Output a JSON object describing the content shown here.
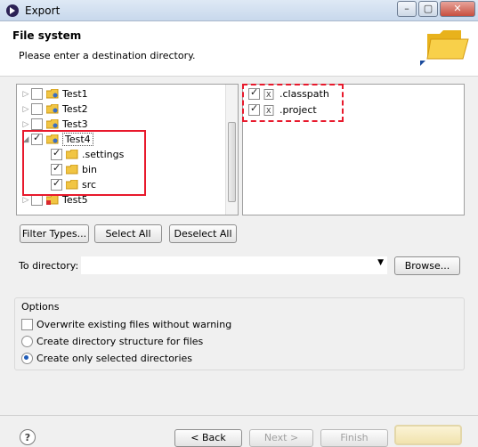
{
  "window": {
    "title": "Export",
    "minimize": "–",
    "maximize": "▢",
    "close": "✕"
  },
  "header": {
    "title": "File system",
    "subtitle": "Please enter a destination directory."
  },
  "left_tree": [
    {
      "label": "Test1",
      "checked": false
    },
    {
      "label": "Test2",
      "checked": false
    },
    {
      "label": "Test3",
      "checked": false
    },
    {
      "label": "Test4",
      "checked": true
    },
    {
      "label": ".settings",
      "checked": true
    },
    {
      "label": "bin",
      "checked": true
    },
    {
      "label": "src",
      "checked": true
    },
    {
      "label": "Test5",
      "checked": false
    }
  ],
  "right_list": [
    {
      "label": ".classpath",
      "checked": true
    },
    {
      "label": ".project",
      "checked": true
    }
  ],
  "buttons": {
    "filter_types": "Filter Types...",
    "select_all": "Select All",
    "deselect_all": "Deselect All",
    "browse": "Browse...",
    "back": "< Back",
    "next": "Next >",
    "finish": "Finish"
  },
  "to_directory": {
    "label": "To directory:",
    "value": ""
  },
  "options": {
    "title": "Options",
    "overwrite": {
      "label": "Overwrite existing files without warning",
      "checked": false
    },
    "create_structure": {
      "label": "Create directory structure for files",
      "selected": false
    },
    "create_selected": {
      "label": "Create only selected directories",
      "selected": true
    }
  },
  "footer": {
    "help": "?"
  },
  "colors": {
    "highlight": "#e8192c",
    "folder": "#f1c543"
  }
}
